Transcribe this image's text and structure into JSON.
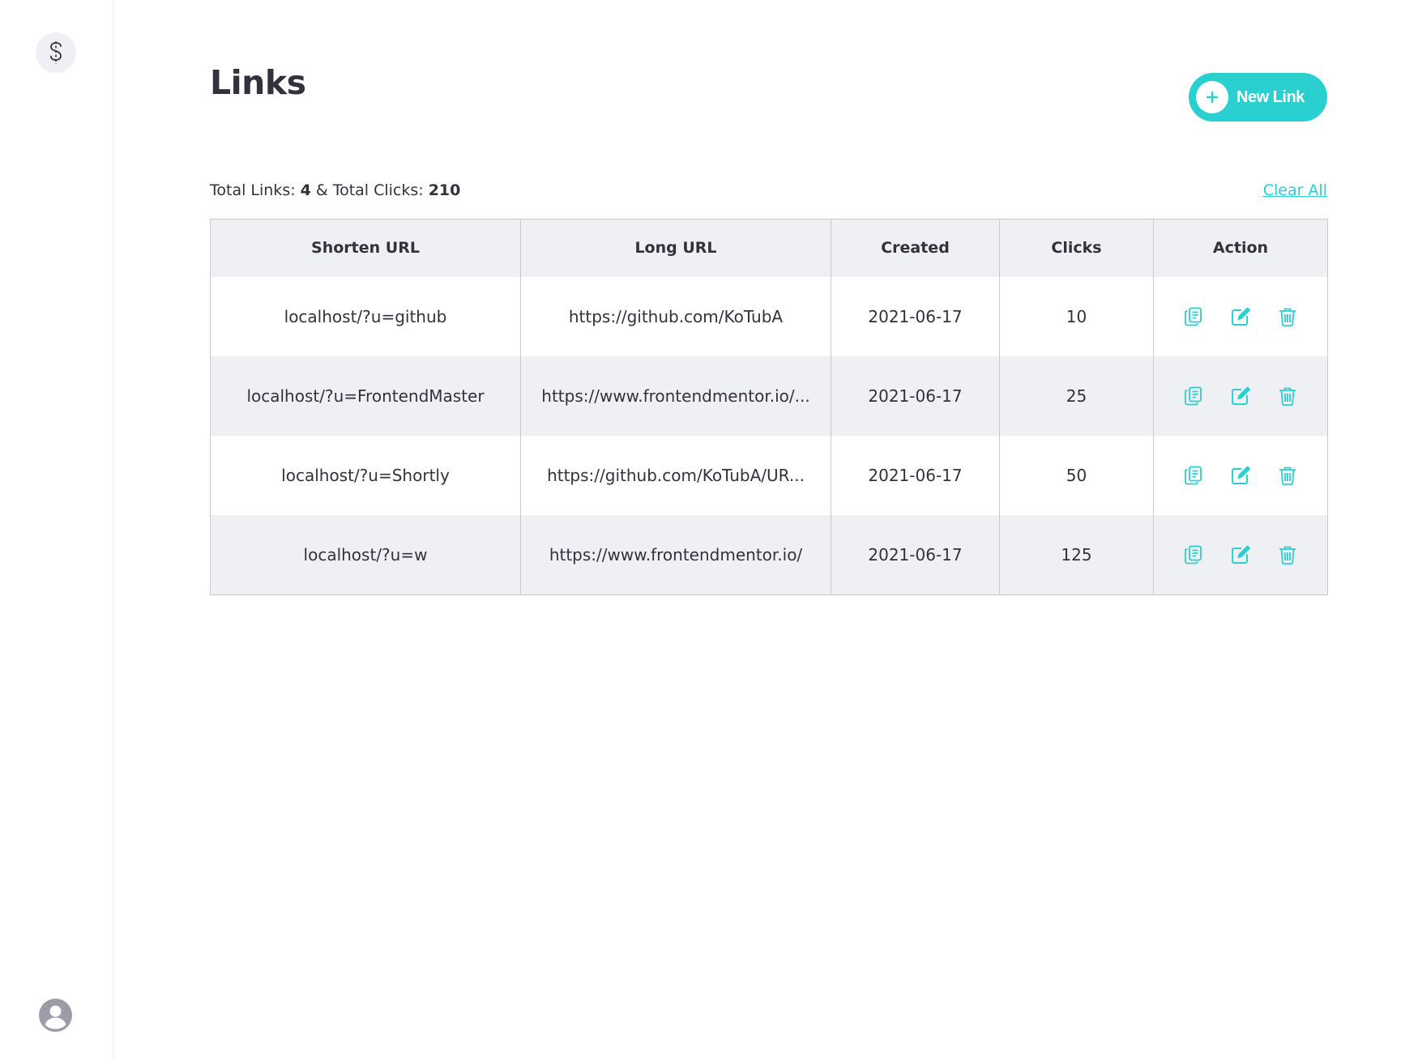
{
  "main": {
    "title": "Links",
    "new_link_label": "New Link"
  },
  "summary": {
    "total_links_label": "Total Links:",
    "total_links": "4",
    "separator": "&",
    "total_clicks_label": "Total Clicks:",
    "total_clicks": "210",
    "clear_all_label": "Clear All"
  },
  "table": {
    "headers": [
      "Shorten URL",
      "Long URL",
      "Created",
      "Clicks",
      "Action"
    ],
    "rows": [
      {
        "short": "localhost/?u=github",
        "long": "https://github.com/KoTubA",
        "created": "2021-06-17",
        "clicks": "10"
      },
      {
        "short": "localhost/?u=FrontendMaster",
        "long": "https://www.frontendmentor.io/...",
        "created": "2021-06-17",
        "clicks": "25"
      },
      {
        "short": "localhost/?u=Shortly",
        "long": "https://github.com/KoTubA/UR...",
        "created": "2021-06-17",
        "clicks": "50"
      },
      {
        "short": "localhost/?u=w",
        "long": "https://www.frontendmentor.io/",
        "created": "2021-06-17",
        "clicks": "125"
      }
    ]
  },
  "icons": {
    "logo": "dollar-sign-icon",
    "avatar": "user-avatar-icon",
    "new_link": "plus-icon",
    "copy": "copy-icon",
    "edit": "edit-icon",
    "delete": "trash-icon"
  },
  "colors": {
    "accent": "#2acfcf",
    "text": "#34313d",
    "row_alt": "#eff0f4",
    "avatar": "#9e9aa7"
  }
}
